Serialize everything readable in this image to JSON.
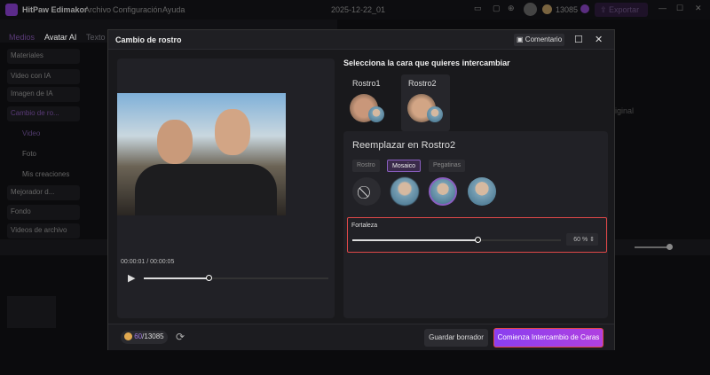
{
  "app": {
    "title": "HitPaw Edimakor",
    "menu": [
      "Archivo",
      "Configuración",
      "Ayuda"
    ],
    "project": "2025-12-22_01",
    "credits": "13085",
    "export": "Exportar"
  },
  "toolbar": {
    "tabs": [
      "Medios",
      "Avatar AI",
      "Texto"
    ]
  },
  "sidebar": {
    "items": [
      "Materiales",
      "Video con IA",
      "Imagen de IA",
      "Cambio de ro...",
      "Mejorador d...",
      "Fondo",
      "Videos de archivo"
    ],
    "sub": [
      "Video",
      "Foto",
      "Mis creaciones"
    ]
  },
  "background": {
    "right_text": "iginal"
  },
  "modal": {
    "title": "Cambio de rostro",
    "feedback": "Comentario",
    "player": {
      "time": "00:00:01 / 00:00:05",
      "progress": 0.35
    },
    "select_title": "Selecciona la cara que quieres intercambiar",
    "faces": [
      "Rostro1",
      "Rostro2"
    ],
    "selected_face": "Rostro2",
    "replace_title": "Reemplazar en Rostro2",
    "modes": [
      "Rostro",
      "Mosaico",
      "Pegatinas"
    ],
    "selected_mode": "Mosaico",
    "strength": {
      "label": "Fortaleza",
      "value": "60 %",
      "percent": 60
    },
    "footer": {
      "credits_used": "60",
      "credits_total": "/13085",
      "save_draft": "Guardar borrador",
      "start": "Comienza Intercambio de Caras"
    }
  },
  "colors": {
    "accent": "#8a3ff0",
    "highlight": "#e04848"
  }
}
